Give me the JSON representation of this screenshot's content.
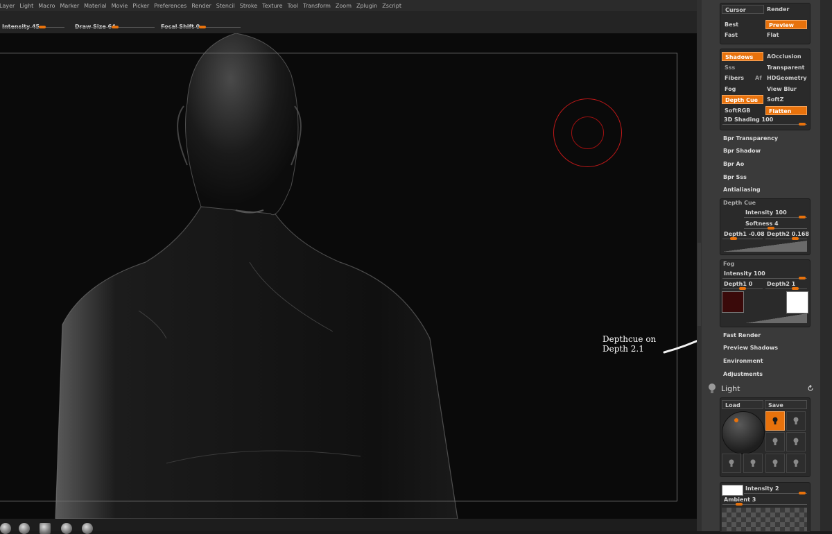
{
  "menu": [
    "Layer",
    "Light",
    "Macro",
    "Marker",
    "Material",
    "Movie",
    "Picker",
    "Preferences",
    "Render",
    "Stencil",
    "Stroke",
    "Texture",
    "Tool",
    "Transform",
    "Zoom",
    "Zplugin",
    "Zscript"
  ],
  "toolbar": {
    "intensity": {
      "label": "Intensity",
      "value": "45",
      "level": 0.45
    },
    "draw_size": {
      "label": "Draw Size",
      "value": "64",
      "level": 0.55
    },
    "focal_shift": {
      "label": "Focal Shift",
      "value": "0",
      "level": 0.5
    }
  },
  "annotation": {
    "line1": "Depthcue on",
    "line2": "Depth 2.1"
  },
  "render_panel": {
    "cursor": "Cursor",
    "render": "Render",
    "best": "Best",
    "preview": "Preview",
    "fast": "Fast",
    "flat": "Flat"
  },
  "bpr_panel": {
    "shadows": "Shadows",
    "aocclusion": "AOcclusion",
    "sss": "Sss",
    "transparent": "Transparent",
    "fibers": "Fibers",
    "af": "Af",
    "hdgeometry": "HDGeometry",
    "fog": "Fog",
    "view_blur": "View Blur",
    "depth_cue": "Depth Cue",
    "softz": "SoftZ",
    "softrgb": "SoftRGB",
    "flatten": "Flatten",
    "shading_label": "3D Shading",
    "shading_value": "100"
  },
  "menu_items": {
    "bpr_transparency": "Bpr Transparency",
    "bpr_shadow": "Bpr Shadow",
    "bpr_ao": "Bpr Ao",
    "bpr_sss": "Bpr Sss",
    "antialiasing": "Antialiasing",
    "fast_render": "Fast Render",
    "preview_shadows": "Preview Shadows",
    "environment": "Environment",
    "adjustments": "Adjustments"
  },
  "depth_cue": {
    "title": "Depth Cue",
    "intensity_label": "Intensity",
    "intensity_value": "100",
    "softness_label": "Softness",
    "softness_value": "4",
    "depth1_label": "Depth1",
    "depth1_value": "-0.08",
    "depth2_label": "Depth2",
    "depth2_value": "0.168"
  },
  "fog": {
    "title": "Fog",
    "intensity_label": "Intensity",
    "intensity_value": "100",
    "depth1_label": "Depth1",
    "depth1_value": "0",
    "depth2_label": "Depth2",
    "depth2_value": "1",
    "color1": "#3a0a0a",
    "color2": "#ffffff"
  },
  "light": {
    "title": "Light",
    "load": "Load",
    "save": "Save",
    "intensity_label": "Intensity",
    "intensity_value": "2",
    "ambient_label": "Ambient",
    "ambient_value": "3"
  },
  "colors": {
    "accent": "#e8720c",
    "brush": "#c01818"
  }
}
